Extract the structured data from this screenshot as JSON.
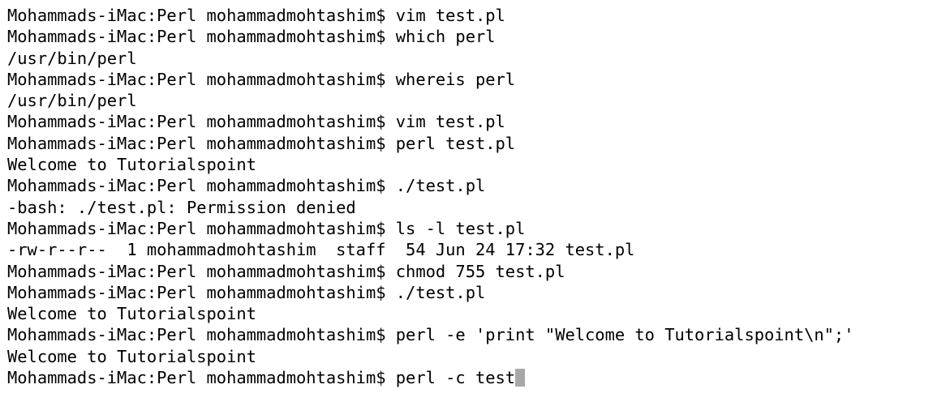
{
  "terminal": {
    "lines": [
      "Mohammads-iMac:Perl mohammadmohtashim$ vim test.pl",
      "Mohammads-iMac:Perl mohammadmohtashim$ which perl",
      "/usr/bin/perl",
      "Mohammads-iMac:Perl mohammadmohtashim$ whereis perl",
      "/usr/bin/perl",
      "Mohammads-iMac:Perl mohammadmohtashim$ vim test.pl",
      "Mohammads-iMac:Perl mohammadmohtashim$ perl test.pl",
      "Welcome to Tutorialspoint",
      "Mohammads-iMac:Perl mohammadmohtashim$ ./test.pl",
      "-bash: ./test.pl: Permission denied",
      "Mohammads-iMac:Perl mohammadmohtashim$ ls -l test.pl",
      "-rw-r--r--  1 mohammadmohtashim  staff  54 Jun 24 17:32 test.pl",
      "Mohammads-iMac:Perl mohammadmohtashim$ chmod 755 test.pl",
      "Mohammads-iMac:Perl mohammadmohtashim$ ./test.pl",
      "Welcome to Tutorialspoint",
      "Mohammads-iMac:Perl mohammadmohtashim$ perl -e 'print \"Welcome to Tutorialspoint\\n\";'",
      "Welcome to Tutorialspoint"
    ],
    "current_input": "Mohammads-iMac:Perl mohammadmohtashim$ perl -c test"
  },
  "colors": {
    "background": "#ffffff",
    "text": "#000000",
    "cursor": "#a8a8a8"
  }
}
